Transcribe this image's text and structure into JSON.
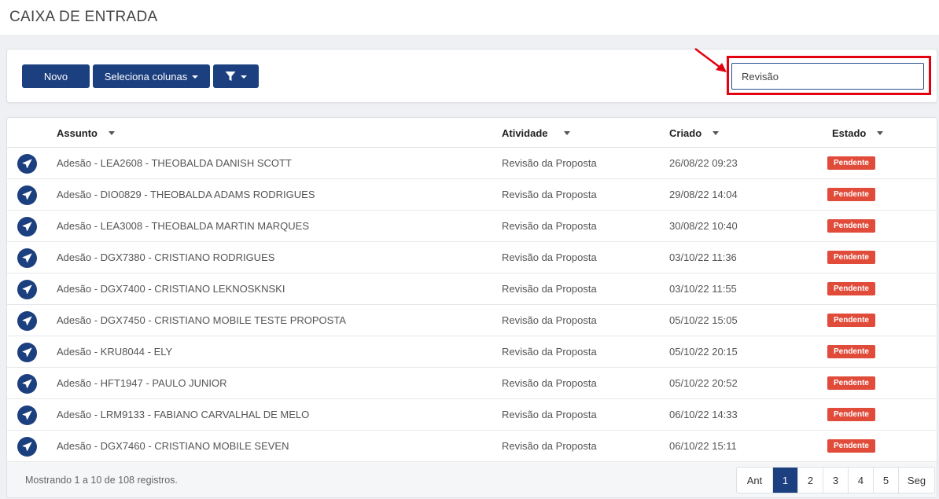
{
  "header": {
    "title": "CAIXA DE ENTRADA"
  },
  "toolbar": {
    "new_label": "Novo",
    "columns_label": "Seleciona colunas",
    "filter_icon": "filter-icon"
  },
  "search": {
    "value": "Revisão",
    "placeholder": ""
  },
  "table": {
    "columns": [
      "Assunto",
      "Atividade",
      "Criado",
      "Estado"
    ],
    "rows": [
      {
        "subject": "Adesão - LEA2608 - THEOBALDA DANISH SCOTT",
        "activity": "Revisão da Proposta",
        "created": "26/08/22 09:23",
        "status": "Pendente"
      },
      {
        "subject": "Adesão - DIO0829 - THEOBALDA ADAMS RODRIGUES",
        "activity": "Revisão da Proposta",
        "created": "29/08/22 14:04",
        "status": "Pendente"
      },
      {
        "subject": "Adesão - LEA3008 - THEOBALDA MARTIN MARQUES",
        "activity": "Revisão da Proposta",
        "created": "30/08/22 10:40",
        "status": "Pendente"
      },
      {
        "subject": "Adesão - DGX7380 - CRISTIANO RODRIGUES",
        "activity": "Revisão da Proposta",
        "created": "03/10/22 11:36",
        "status": "Pendente"
      },
      {
        "subject": "Adesão - DGX7400 - CRISTIANO LEKNOSKNSKI",
        "activity": "Revisão da Proposta",
        "created": "03/10/22 11:55",
        "status": "Pendente"
      },
      {
        "subject": "Adesão - DGX7450 - CRISTIANO MOBILE TESTE PROPOSTA",
        "activity": "Revisão da Proposta",
        "created": "05/10/22 15:05",
        "status": "Pendente"
      },
      {
        "subject": "Adesão - KRU8044 - ELY",
        "activity": "Revisão da Proposta",
        "created": "05/10/22 20:15",
        "status": "Pendente"
      },
      {
        "subject": "Adesão - HFT1947 - PAULO JUNIOR",
        "activity": "Revisão da Proposta",
        "created": "05/10/22 20:52",
        "status": "Pendente"
      },
      {
        "subject": "Adesão - LRM9133 - FABIANO CARVALHAL DE MELO",
        "activity": "Revisão da Proposta",
        "created": "06/10/22 14:33",
        "status": "Pendente"
      },
      {
        "subject": "Adesão - DGX7460 - CRISTIANO MOBILE SEVEN",
        "activity": "Revisão da Proposta",
        "created": "06/10/22 15:11",
        "status": "Pendente"
      }
    ],
    "row_icon": "send-icon"
  },
  "footer": {
    "info": "Mostrando 1 a 10 de 108 registros.",
    "prev_label": "Ant",
    "next_label": "Seg",
    "pages": [
      "1",
      "2",
      "3",
      "4",
      "5"
    ],
    "current_page": "1"
  },
  "colors": {
    "primary": "#1b3f7f",
    "badge": "#e04b3a",
    "annotation": "#e3000f"
  }
}
